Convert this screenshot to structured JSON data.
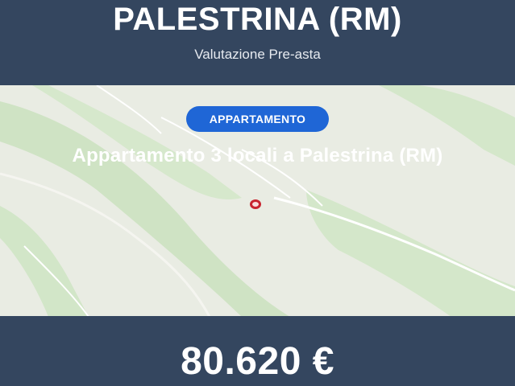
{
  "header": {
    "title": "PALESTRINA (RM)",
    "subtitle": "Valutazione Pre-asta"
  },
  "listing": {
    "type_badge": "APPARTAMENTO",
    "headline": "Appartamento 3 locali a Palestrina (RM)",
    "price": "80.620 €"
  },
  "colors": {
    "header_bg": "#34465f",
    "badge_bg": "#1f66d6",
    "pin": "#c8242f",
    "map_land": "#e9ece3",
    "map_green": "#cfe3c4"
  },
  "icons": {
    "map_marker": "location-pin-icon"
  }
}
